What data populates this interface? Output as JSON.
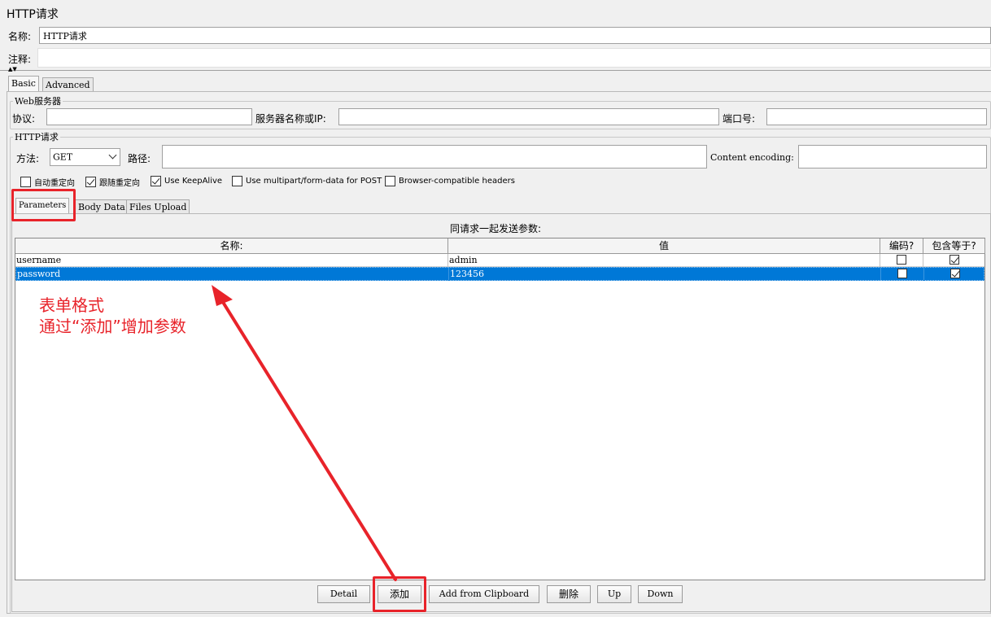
{
  "panel": {
    "title": "HTTP请求"
  },
  "name_field": {
    "label": "名称:",
    "value": "HTTP请求"
  },
  "comment_field": {
    "label": "注释:",
    "value": ""
  },
  "main_tabs": [
    {
      "label": "Basic"
    },
    {
      "label": "Advanced"
    }
  ],
  "web_server": {
    "title": "Web服务器",
    "protocol_label": "协议:",
    "protocol_value": "",
    "server_label": "服务器名称或IP:",
    "server_value": "",
    "port_label": "端口号:",
    "port_value": ""
  },
  "http_request": {
    "title": "HTTP请求",
    "method_label": "方法:",
    "method_value": "GET",
    "path_label": "路径:",
    "path_value": "",
    "encoding_label": "Content encoding:",
    "encoding_value": ""
  },
  "options": [
    {
      "label": "自动重定向",
      "checked": false
    },
    {
      "label": "跟随重定向",
      "checked": true
    },
    {
      "label": "Use KeepAlive",
      "checked": true
    },
    {
      "label": "Use multipart/form-data for POST",
      "checked": false
    },
    {
      "label": "Browser-compatible headers",
      "checked": false
    }
  ],
  "sub_tabs": [
    {
      "label": "Parameters"
    },
    {
      "label": "Body Data"
    },
    {
      "label": "Files Upload"
    }
  ],
  "params": {
    "caption": "同请求一起发送参数:",
    "columns": [
      "名称:",
      "值",
      "编码?",
      "包含等于?"
    ],
    "rows": [
      {
        "name": "username",
        "value": "admin",
        "encode": false,
        "include_equals": true,
        "selected": false
      },
      {
        "name": "password",
        "value": "123456",
        "encode": false,
        "include_equals": true,
        "selected": true
      }
    ]
  },
  "annotation": {
    "line1": "表单格式",
    "line2": "通过“添加”增加参数"
  },
  "buttons": {
    "detail": "Detail",
    "add": "添加",
    "add_clipboard": "Add from Clipboard",
    "delete": "删除",
    "up": "Up",
    "down": "Down"
  },
  "colors": {
    "selection": "#0078d7",
    "annotation": "#e8232a"
  }
}
